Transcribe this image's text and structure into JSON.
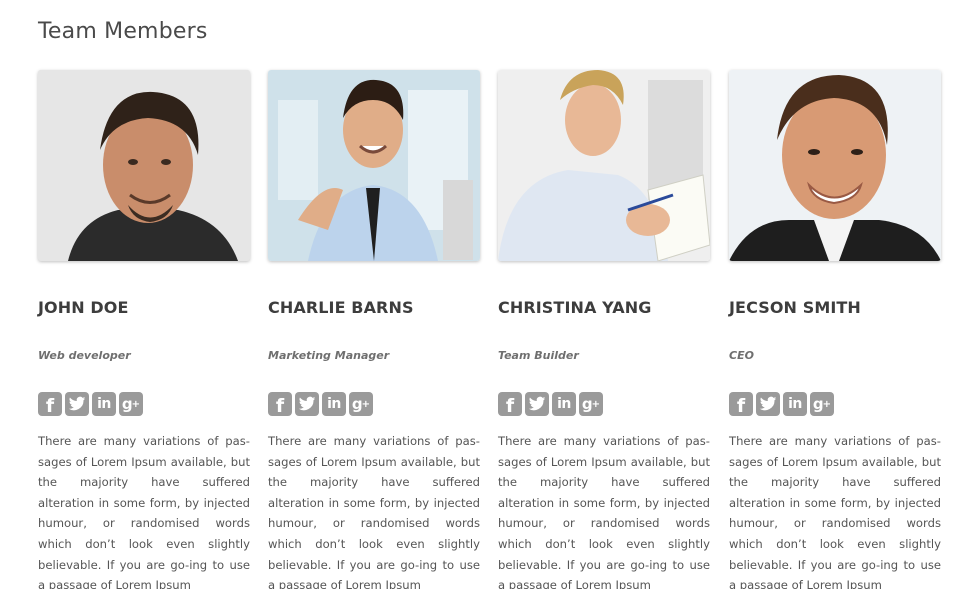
{
  "section": {
    "title": "Team Members"
  },
  "members": [
    {
      "name": "JOHN DOE",
      "role": "Web developer",
      "bio": "There are many variations of pas-sages of Lorem Ipsum available, but the majority have suffered alteration in some form, by injected humour, or randomised words which don’t look even slightly believable. If you are go-ing to use a passage of Lorem Ipsum",
      "photo_icon": "portrait-photo"
    },
    {
      "name": "CHARLIE BARNS",
      "role": "Marketing Manager",
      "bio": "There are many variations of pas-sages of Lorem Ipsum available, but the majority have suffered alteration in some form, by injected humour, or randomised words which don’t look even slightly believable. If you are go-ing to use a passage of Lorem Ipsum",
      "photo_icon": "portrait-photo"
    },
    {
      "name": "CHRISTINA YANG",
      "role": "Team Builder",
      "bio": "There are many variations of pas-sages of Lorem Ipsum available, but the majority have suffered alteration in some form, by injected humour, or randomised words which don’t look even slightly believable. If you are go-ing to use a passage of Lorem Ipsum",
      "photo_icon": "portrait-photo"
    },
    {
      "name": "JECSON SMITH",
      "role": "CEO",
      "bio": "There are many variations of pas-sages of Lorem Ipsum available, but the majority have suffered alteration in some form, by injected humour, or randomised words which don’t look even slightly believable. If you are go-ing to use a passage of Lorem Ipsum",
      "photo_icon": "portrait-photo"
    }
  ],
  "social": {
    "facebook_glyph": "f",
    "linkedin_glyph": "in",
    "googleplus_glyph": "g",
    "googleplus_sup": "+",
    "icons": [
      "facebook-icon",
      "twitter-icon",
      "linkedin-icon",
      "google-plus-icon"
    ]
  },
  "colors": {
    "social_icon_bg": "#9a9a9a",
    "name_text": "#3d3d3d",
    "role_text": "#6f6f6f",
    "body_text": "#555555",
    "title_text": "#4a4a4a"
  }
}
